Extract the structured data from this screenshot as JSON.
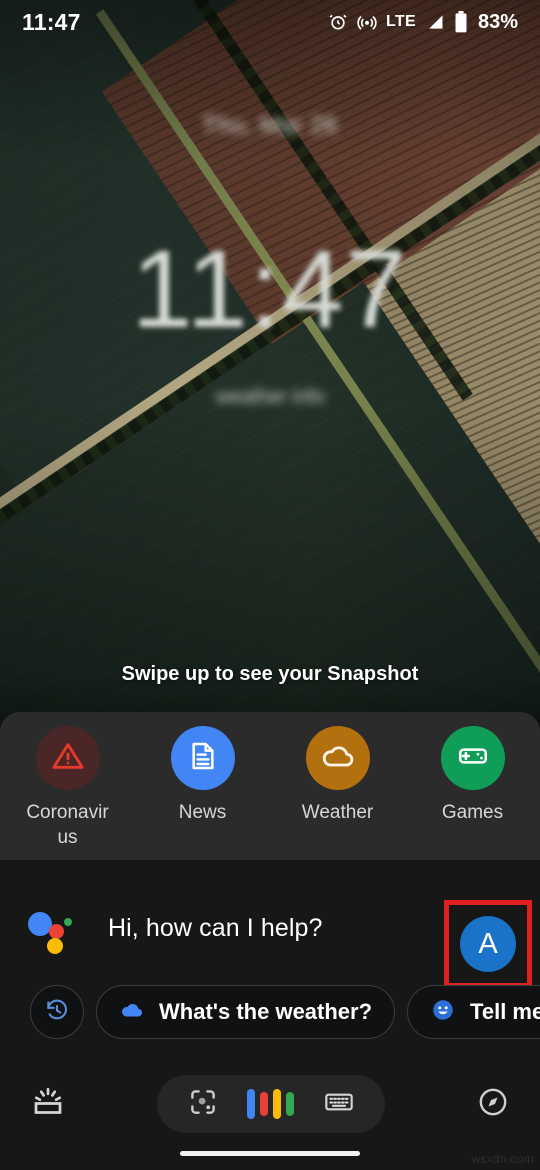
{
  "status_bar": {
    "time": "11:47",
    "icons": [
      "alarm-icon",
      "cast-icon",
      "signal-icon",
      "battery-icon"
    ],
    "network_label": "LTE",
    "battery_percent": "83%"
  },
  "lockscreen": {
    "date_blurred": "Thu, Mar 26",
    "clock": "11:47",
    "sub_blurred": "weather info",
    "swipe_hint": "Swipe up to see your Snapshot"
  },
  "shortcuts": {
    "items": [
      {
        "label": "Coronavirus",
        "icon": "warning-triangle-icon",
        "circle_color": "#4a2626",
        "icon_color": "#e8392a"
      },
      {
        "label": "News",
        "icon": "document-icon",
        "circle_color": "#4285f4",
        "icon_color": "#ffffff"
      },
      {
        "label": "Weather",
        "icon": "cloud-icon",
        "circle_color": "#b2700f",
        "icon_color": "#ffffff"
      },
      {
        "label": "Games",
        "icon": "gamepad-icon",
        "circle_color": "#0f9d58",
        "icon_color": "#ffffff"
      }
    ]
  },
  "assistant": {
    "logo": "google-assistant-logo",
    "greeting": "Hi, how can I help?",
    "avatar_letter": "A",
    "avatar_color": "#1a73c9",
    "highlight_color": "#e02020",
    "chips": [
      {
        "label": "",
        "icon": "history-icon"
      },
      {
        "label": "What's the weather?",
        "icon": "cloud-icon"
      },
      {
        "label": "Tell me",
        "icon": "smiley-icon"
      }
    ]
  },
  "bottom_bar": {
    "snapshot_icon": "snapshot-icon",
    "lens_icon": "google-lens-icon",
    "mic_icon": "assistant-mic-bars-icon",
    "keyboard_icon": "keyboard-icon",
    "explore_icon": "compass-explore-icon"
  },
  "watermark": "wsxdn.com"
}
